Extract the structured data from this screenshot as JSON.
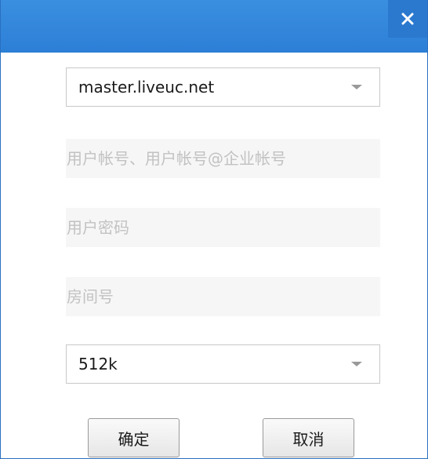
{
  "titlebar": {
    "close_icon": "close-icon"
  },
  "server_select": {
    "value": "master.liveuc.net",
    "icon": "dropdown-arrow-icon"
  },
  "account_input": {
    "value": "",
    "placeholder": "用户帐号、用户帐号@企业帐号"
  },
  "password_input": {
    "value": "",
    "placeholder": "用户密码"
  },
  "room_input": {
    "value": "",
    "placeholder": "房间号"
  },
  "bandwidth_select": {
    "value": "512k",
    "icon": "dropdown-arrow-icon"
  },
  "buttons": {
    "ok_label": "确定",
    "cancel_label": "取消"
  },
  "colors": {
    "titlebar": "#2c7fd6",
    "close_button": "#2a79cf",
    "input_background": "#f6f6f6",
    "placeholder": "#c2c2c2"
  }
}
